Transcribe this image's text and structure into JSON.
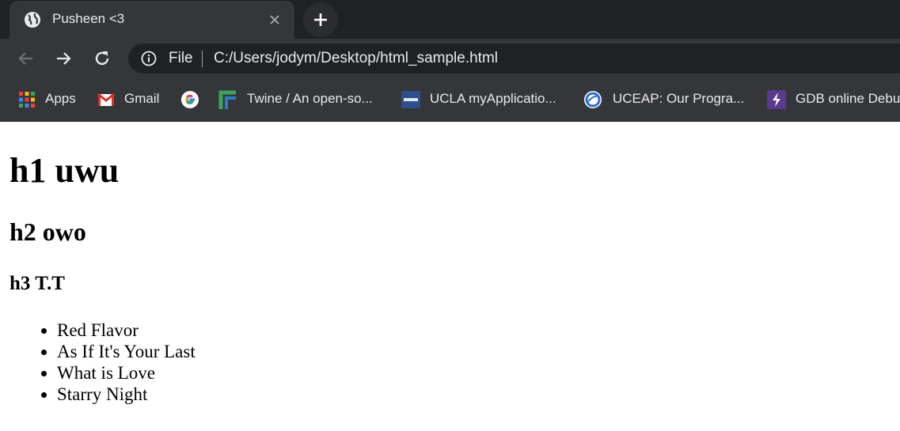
{
  "browser": {
    "tab": {
      "title": "Pusheen <3",
      "favicon": "globe-icon"
    },
    "new_tab_icon": "plus-icon",
    "omnibox": {
      "scheme": "File",
      "url": "C:/Users/jodym/Desktop/html_sample.html"
    },
    "bookmarks": [
      {
        "label": "Apps",
        "icon": "apps-grid-icon"
      },
      {
        "label": "Gmail",
        "icon": "gmail-icon"
      },
      {
        "label": "",
        "icon": "google-icon"
      },
      {
        "label": "Twine / An open-so...",
        "icon": "twine-icon"
      },
      {
        "label": "UCLA myApplicatio...",
        "icon": "ucla-icon"
      },
      {
        "label": "UCEAP: Our Progra...",
        "icon": "uceap-icon"
      },
      {
        "label": "GDB online Debu",
        "icon": "gdb-icon"
      }
    ]
  },
  "page": {
    "h1": "h1 uwu",
    "h2": "h2 owo",
    "h3": "h3 T.T",
    "list": [
      "Red Flavor",
      "As If It's Your Last",
      "What is Love",
      "Starry Night"
    ]
  },
  "colors": {
    "tabstrip": "#202124",
    "toolbar": "#35363a",
    "omnibox": "#202124",
    "text_light": "#e8eaed"
  }
}
